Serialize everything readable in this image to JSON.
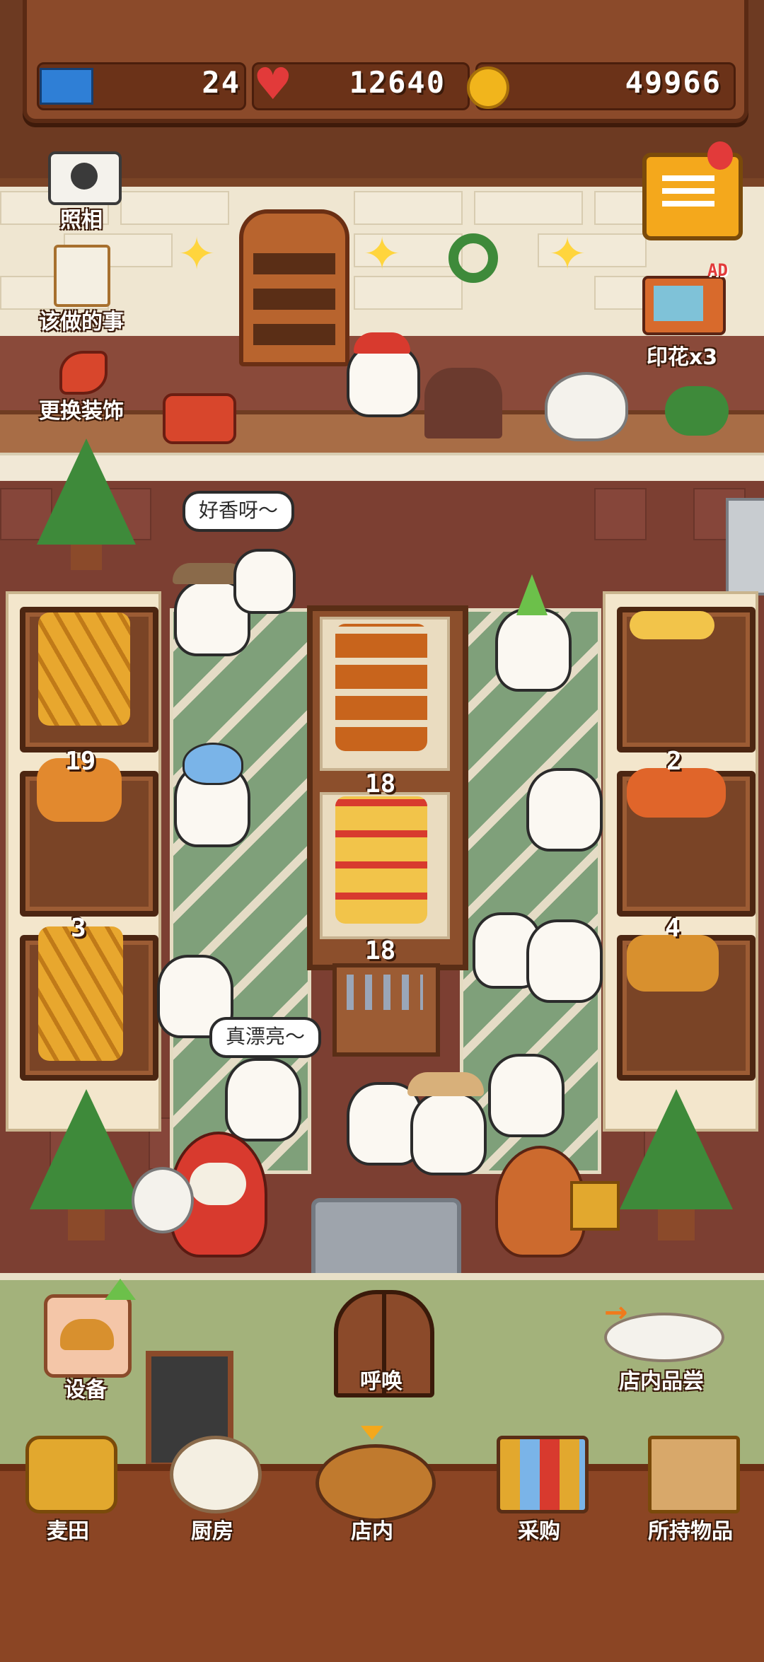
{
  "resources": {
    "tickets": "24",
    "hearts": "12640",
    "coins": "49966"
  },
  "side_buttons": {
    "camera": "照相",
    "todo": "该做的事",
    "decorate": "更换装饰",
    "stamps": "印花x3",
    "ad_badge": "AD"
  },
  "speech": {
    "bubble1": "好香呀～",
    "bubble2": "真漂亮～"
  },
  "stock_counts": {
    "left_mid": "19",
    "left_bottom": "3",
    "center_top": "18",
    "center_bottom": "18",
    "right_mid": "2",
    "right_bottom": "4"
  },
  "yard_buttons": {
    "equipment": "设备",
    "summon": "呼唤",
    "tasting": "店内品尝"
  },
  "nav": {
    "wheat_field": "麦田",
    "kitchen": "厨房",
    "shop": "店内",
    "purchase": "采购",
    "inventory": "所持物品"
  },
  "colors": {
    "wood": "#8b4524",
    "carpet": "#7fa07a",
    "heart": "#e23a3a",
    "coin": "#f1b51c",
    "ticket": "#2f7fd6"
  }
}
